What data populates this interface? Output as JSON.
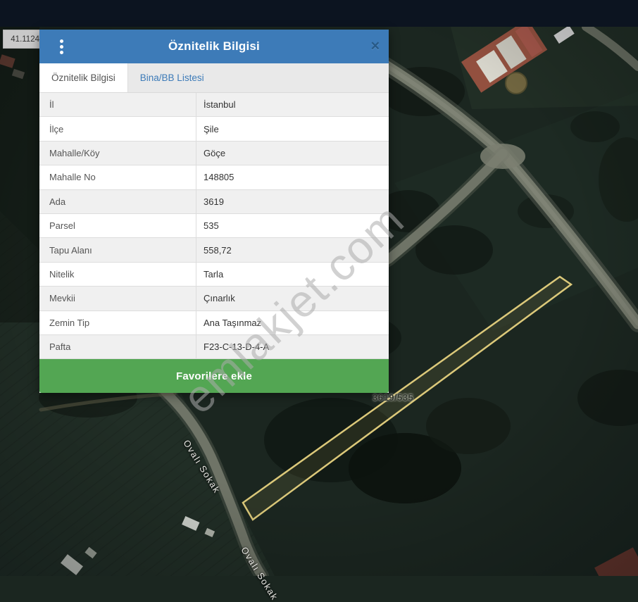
{
  "colors": {
    "header_blue": "#3d7bb8",
    "tab_link_blue": "#3d7bb8",
    "button_green": "#53a653",
    "parcel_outline": "#dcc97a",
    "topbar_dark": "#0c1420"
  },
  "icons": {
    "close": "✕"
  },
  "map": {
    "coordinate_value": "41.1124",
    "parcel_label": "3619/535",
    "street_label": "Ovalı Sokak",
    "street_label_bottom": "Ovalı Sokak"
  },
  "watermark": {
    "text": "emlakjet.com"
  },
  "modal": {
    "title": "Öznitelik Bilgisi",
    "tabs": [
      {
        "label": "Öznitelik Bilgisi",
        "active": true
      },
      {
        "label": "Bina/BB Listesi",
        "active": false
      }
    ],
    "rows": [
      {
        "label": "İl",
        "value": "İstanbul"
      },
      {
        "label": "İlçe",
        "value": "Şile"
      },
      {
        "label": "Mahalle/Köy",
        "value": "Göçe"
      },
      {
        "label": "Mahalle No",
        "value": "148805"
      },
      {
        "label": "Ada",
        "value": "3619"
      },
      {
        "label": "Parsel",
        "value": "535"
      },
      {
        "label": "Tapu Alanı",
        "value": "558,72"
      },
      {
        "label": "Nitelik",
        "value": "Tarla"
      },
      {
        "label": "Mevkii",
        "value": "Çınarlık"
      },
      {
        "label": "Zemin Tip",
        "value": "Ana Taşınmaz"
      },
      {
        "label": "Pafta",
        "value": "F23-C-13-D-4-A"
      }
    ],
    "favorite_button": "Favorilere ekle"
  }
}
